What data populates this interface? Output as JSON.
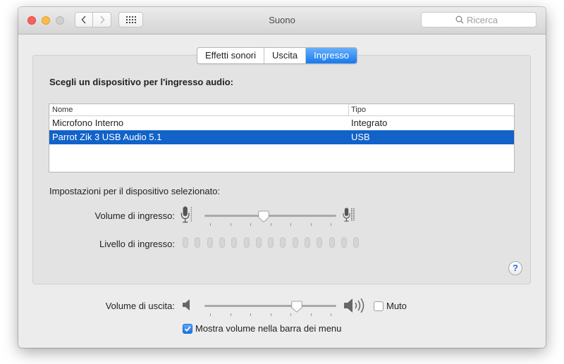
{
  "window": {
    "title": "Suono"
  },
  "search": {
    "placeholder": "Ricerca"
  },
  "tabs": [
    {
      "label": "Effetti sonori",
      "active": false
    },
    {
      "label": "Uscita",
      "active": false
    },
    {
      "label": "Ingresso",
      "active": true
    }
  ],
  "input": {
    "heading": "Scegli un dispositivo per l'ingresso audio:",
    "table": {
      "columns": [
        "Nome",
        "Tipo"
      ],
      "rows": [
        {
          "name": "Microfono Interno",
          "type": "Integrato",
          "selected": false
        },
        {
          "name": "Parrot Zik 3 USB Audio 5.1",
          "type": "USB",
          "selected": true
        }
      ]
    },
    "settings_label": "Impostazioni per il dispositivo selezionato:",
    "volume_label": "Volume di ingresso:",
    "volume_level": 0.45,
    "level_label": "Livello di ingresso:",
    "level_segments": 15,
    "level_active": 0
  },
  "output": {
    "volume_label": "Volume di uscita:",
    "volume_level": 0.7,
    "mute_label": "Muto",
    "mute_checked": false,
    "show_menu_label": "Mostra volume nella barra dei menu",
    "show_menu_checked": true
  },
  "colors": {
    "accent": "#1162c9",
    "tab_active": "#1679ef",
    "close": "#fc605c",
    "minimize": "#fdbc40"
  },
  "icons": [
    "back-chevron-icon",
    "forward-chevron-icon",
    "grid-icon",
    "search-icon",
    "microphone-icon",
    "speaker-icon",
    "help-icon",
    "checkmark-icon"
  ]
}
